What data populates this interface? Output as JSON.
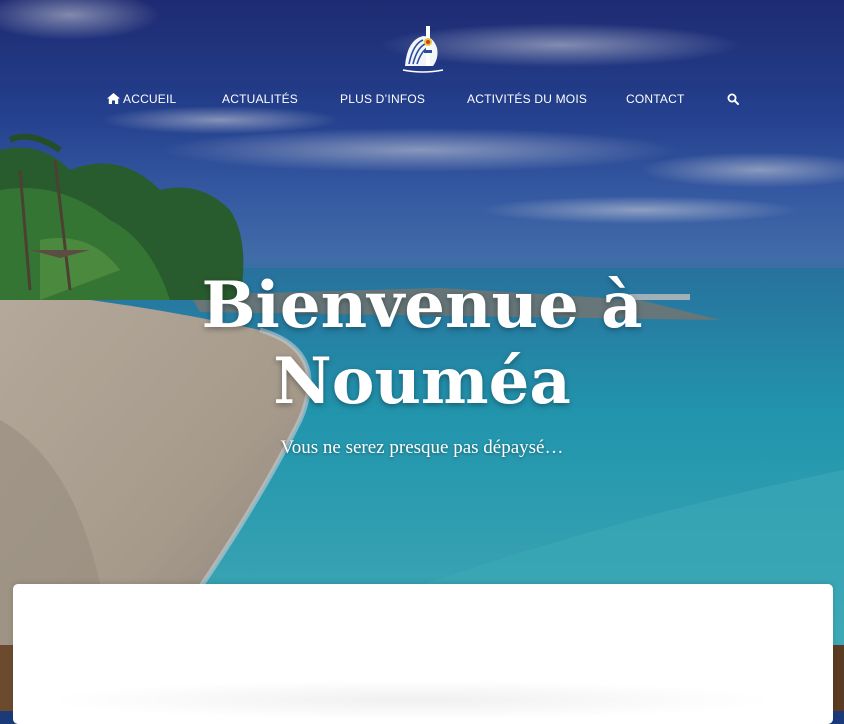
{
  "nav": {
    "home": "ACCUEIL",
    "news": "ACTUALITÉS",
    "more_info": "PLUS D’INFOS",
    "activities": "ACTIVITÉS DU MOIS",
    "contact": "CONTACT",
    "home_icon": "home-icon",
    "search_icon": "search-icon"
  },
  "hero": {
    "title_line1": "Bienvenue à",
    "title_line2": "Nouméa",
    "subtitle": "Vous ne serez presque pas dépaysé…"
  },
  "colors": {
    "text": "#ffffff",
    "card": "#ffffff"
  }
}
